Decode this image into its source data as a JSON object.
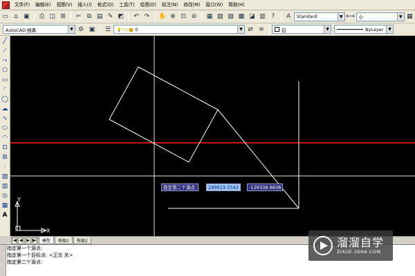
{
  "menu": [
    "文件(F)",
    "编辑(E)",
    "视图(V)",
    "插入(I)",
    "格式(O)",
    "工具(T)",
    "绘图(D)",
    "标注(N)",
    "修改(M)",
    "窗口(W)",
    "帮助(H)"
  ],
  "toolbar1": {
    "text_style_value": "Standard",
    "dim_style_value": "小"
  },
  "toolbar2": {
    "workspace_value": "AutoCAD 经典",
    "layer_value": "0",
    "color_value": "白",
    "linetype_value": "ByLayer"
  },
  "dynamic_input": {
    "prompt": "指定第二个源点:",
    "x_value": "289619.5543",
    "y_value": "-128338.6636"
  },
  "ucs": {
    "x_label": "X",
    "y_label": "Y"
  },
  "tabs": {
    "nav": [
      "|◀",
      "◀",
      "▶",
      "▶|"
    ],
    "items": [
      "模型",
      "布局1",
      "布局2"
    ]
  },
  "command_history": [
    "指定第一个源点:",
    "指定第一个目标点:  <正交 关>",
    "指定第二个源点:"
  ],
  "watermark": {
    "name": "溜溜自学",
    "url": "ZIXUE.3D66.COM"
  },
  "colors": {
    "canvas_bg": "#000000",
    "drawing_lines": "#ffffff",
    "horizontal_ref_line": "#c81414",
    "crosshair": "#e6e6e6",
    "dynamic_input_bg": "#2c2c7a"
  }
}
